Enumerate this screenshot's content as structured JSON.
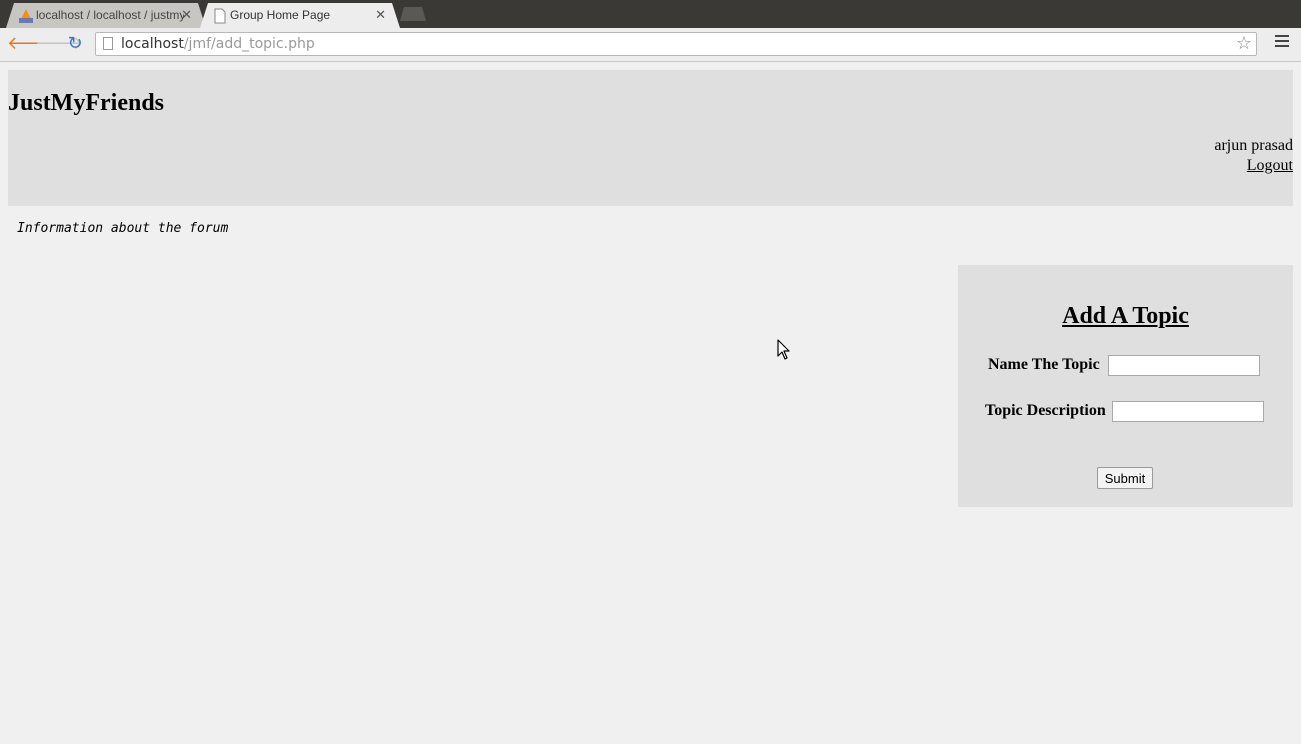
{
  "browser": {
    "tabs": [
      {
        "title": "localhost / localhost / justmyfriends",
        "active": false
      },
      {
        "title": "Group Home Page",
        "active": true
      }
    ],
    "url_host": "localhost",
    "url_path": "/jmf/add_topic.php"
  },
  "header": {
    "site_title": "JustMyFriends",
    "user_name": "arjun prasad",
    "logout_label": "Logout"
  },
  "forum_info": "Information about the forum",
  "add_topic_form": {
    "title": "Add A Topic",
    "name_label": "Name The Topic",
    "name_value": "",
    "description_label": "Topic Description",
    "description_value": "",
    "submit_label": "Submit"
  },
  "colors": {
    "page_background": "#f0f0f0",
    "panel_background": "#dfdfdf"
  }
}
